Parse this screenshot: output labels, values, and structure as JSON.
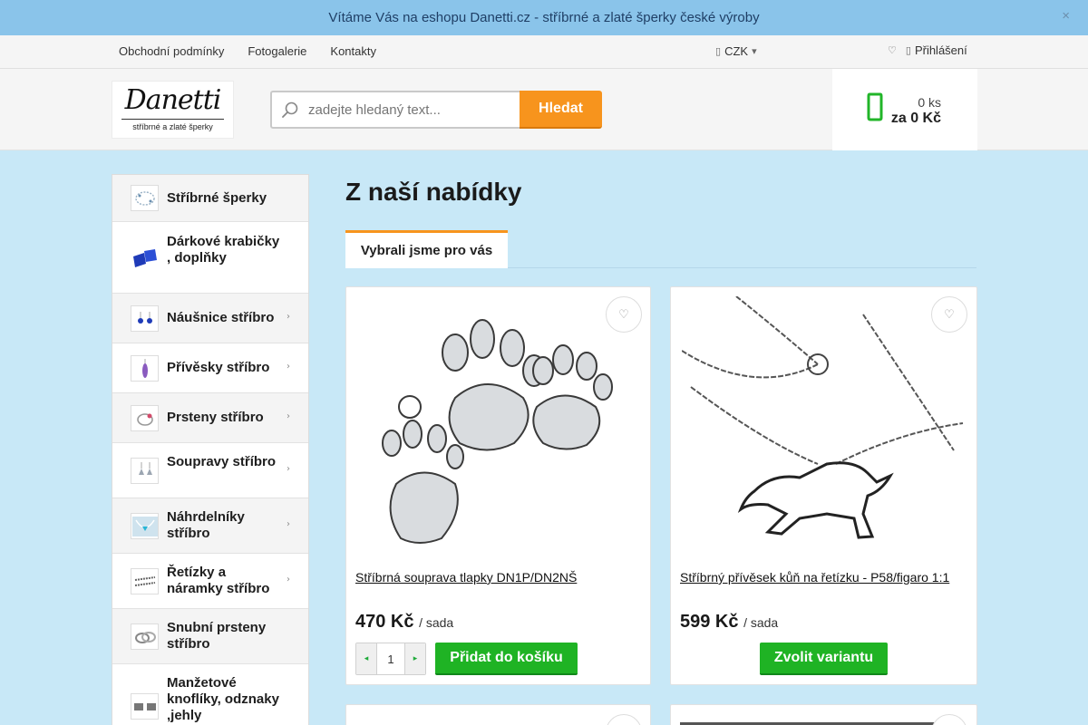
{
  "announcement": {
    "text": "Vítáme Vás na eshopu Danetti.cz - stříbrné a zlaté šperky české výroby",
    "close_icon": "×"
  },
  "top_nav": {
    "links": [
      "Obchodní podmínky",
      "Fotogalerie",
      "Kontakty"
    ],
    "currency": "CZK",
    "login": "Přihlášení"
  },
  "header": {
    "logo_name": "Danetti",
    "logo_tagline": "stříbrné a zlaté šperky",
    "search_placeholder": "zadejte hledaný text...",
    "search_button": "Hledat",
    "cart_count": "0 ks",
    "cart_total": "za 0 Kč"
  },
  "sidebar": {
    "categories": [
      {
        "label": "Stříbrné šperky",
        "has_submenu": false
      },
      {
        "label": "Dárkové krabičky , doplňky",
        "has_submenu": false
      },
      {
        "label": "Náušnice stříbro",
        "has_submenu": true
      },
      {
        "label": "Přívěsky stříbro",
        "has_submenu": true
      },
      {
        "label": "Prsteny stříbro",
        "has_submenu": true
      },
      {
        "label": "Soupravy stříbro",
        "has_submenu": true
      },
      {
        "label": "Náhrdelníky stříbro",
        "has_submenu": true
      },
      {
        "label": "Řetízky a náramky stříbro",
        "has_submenu": true
      },
      {
        "label": "Snubní prsteny stříbro",
        "has_submenu": false
      },
      {
        "label": "Manžetové knoflíky, odznaky ,jehly",
        "has_submenu": false
      }
    ]
  },
  "main": {
    "title": "Z naší nabídky",
    "tab": "Vybrali jsme pro vás",
    "products": [
      {
        "name": "Stříbrná souprava tlapky DN1P/DN2NŠ",
        "price": "470 Kč",
        "unit": "/ sada",
        "quantity": "1",
        "button": "Přidat do košíku"
      },
      {
        "name": "Stříbrný přívěsek kůň na řetízku - P58/figaro 1:1",
        "price": "599 Kč",
        "unit": "/ sada",
        "button": "Zvolit variantu"
      }
    ]
  },
  "colors": {
    "announcement_bg": "#8ac4ea",
    "page_bg": "#c8e8f7",
    "accent_orange": "#f7941d",
    "accent_green": "#1fb324"
  },
  "icons": {
    "search": "search-icon",
    "cart": "cart-icon",
    "wishlist": "heart-icon",
    "user": "user-icon",
    "caret": "chevron-down-icon",
    "category_arrow": "chevron-right-icon"
  }
}
